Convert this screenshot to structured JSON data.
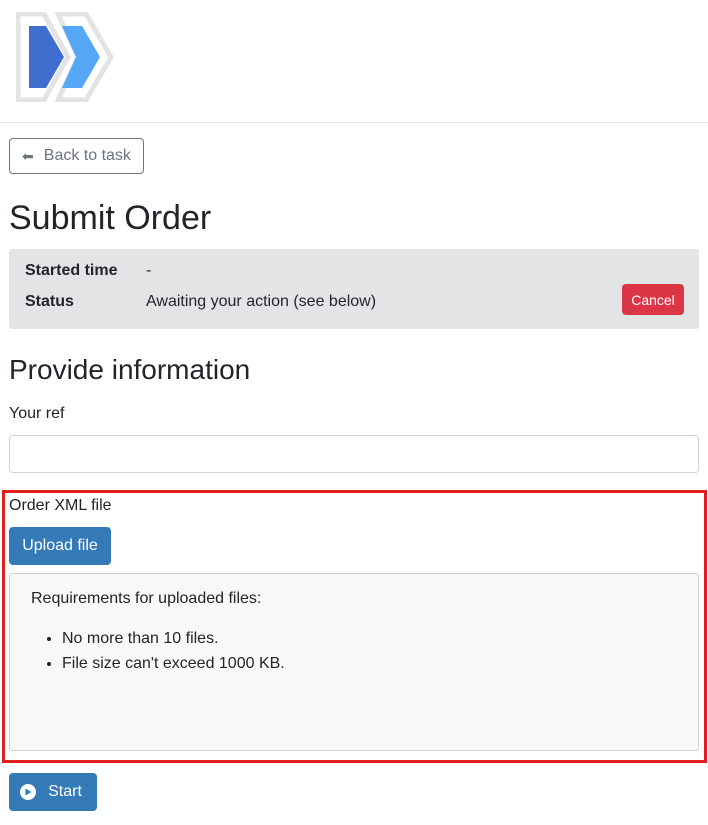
{
  "header": {
    "logo_icon": "double-chevron-logo-icon"
  },
  "nav": {
    "back_label": "Back to task",
    "back_icon": "arrow-left-icon"
  },
  "page": {
    "title": "Submit Order"
  },
  "info": {
    "started_label": "Started time",
    "started_value": "-",
    "status_label": "Status",
    "status_value": "Awaiting your action (see below)",
    "cancel_label": "Cancel"
  },
  "form": {
    "section_title": "Provide information",
    "ref_label": "Your ref",
    "ref_value": "",
    "file_label": "Order XML file",
    "upload_label": "Upload file",
    "requirements_title": "Requirements for uploaded files:",
    "requirements": [
      "No more than 10 files.",
      "File size can't exceed 1000 KB."
    ],
    "start_label": "Start",
    "start_icon": "play-circle-icon"
  },
  "colors": {
    "primary": "#337ab7",
    "danger": "#dc3545",
    "highlight": "#e02020",
    "logo_dark": "#3f6ecf",
    "logo_light": "#55a8f5"
  }
}
